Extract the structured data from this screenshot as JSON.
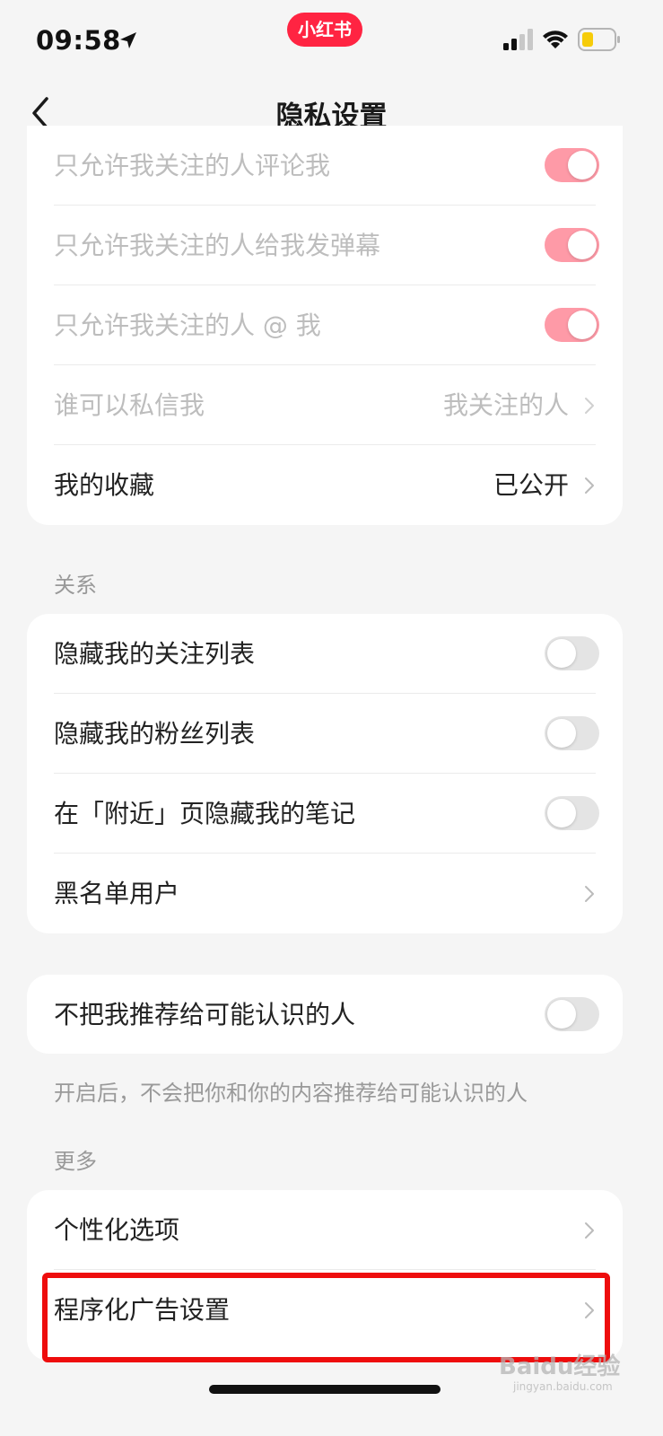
{
  "status_bar": {
    "time": "09:58",
    "app_badge": "小红书",
    "accent": "#ff2442"
  },
  "nav": {
    "title": "隐私设置",
    "back_icon": "chevron-left-icon"
  },
  "card_privacy": {
    "rows": [
      {
        "label": "只允许我关注的人评论我",
        "toggle": true,
        "disabled": true
      },
      {
        "label": "只允许我关注的人给我发弹幕",
        "toggle": true,
        "disabled": true
      },
      {
        "label": "只允许我关注的人 @ 我",
        "toggle": true,
        "disabled": true
      },
      {
        "label": "谁可以私信我",
        "value": "我关注的人",
        "disabled": true
      },
      {
        "label": "我的收藏",
        "value": "已公开",
        "disabled": false
      }
    ]
  },
  "section_relations": {
    "title": "关系",
    "rows": [
      {
        "label": "隐藏我的关注列表",
        "toggle": false
      },
      {
        "label": "隐藏我的粉丝列表",
        "toggle": false
      },
      {
        "label": "在「附近」页隐藏我的笔记",
        "toggle": false
      },
      {
        "label": "黑名单用户"
      }
    ]
  },
  "card_recommend": {
    "label": "不把我推荐给可能认识的人",
    "toggle": false,
    "hint": "开启后，不会把你和你的内容推荐给可能认识的人"
  },
  "section_more": {
    "title": "更多",
    "rows": [
      {
        "label": "个性化选项"
      },
      {
        "label": "程序化广告设置"
      }
    ]
  },
  "watermark": {
    "text": "Baidu经验",
    "sub": "jingyan.baidu.com"
  },
  "colors": {
    "toggle_on_disabled": "#fe9aa7",
    "toggle_off": "#e4e4e4",
    "highlight": "#ee0d0d"
  }
}
